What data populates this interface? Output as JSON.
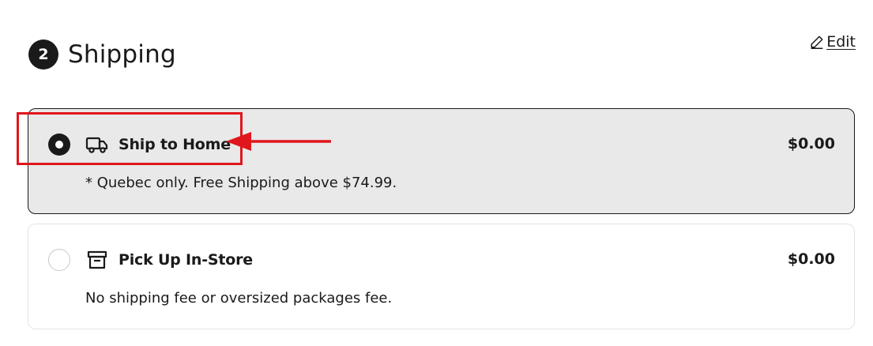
{
  "step": {
    "number": "2",
    "title": "Shipping",
    "edit_label": "Edit"
  },
  "options": [
    {
      "label": "Ship to Home",
      "price": "$0.00",
      "description": "* Quebec only. Free Shipping above $74.99.",
      "icon": "truck-icon",
      "selected": true
    },
    {
      "label": "Pick Up In-Store",
      "price": "$0.00",
      "description": "No shipping fee or oversized packages fee.",
      "icon": "store-icon",
      "selected": false
    }
  ],
  "annotation": {
    "color": "#e0161c",
    "target": "Ship to Home"
  },
  "colors": {
    "selected_bg": "#e9e9e9",
    "text": "#1a1a1a"
  }
}
